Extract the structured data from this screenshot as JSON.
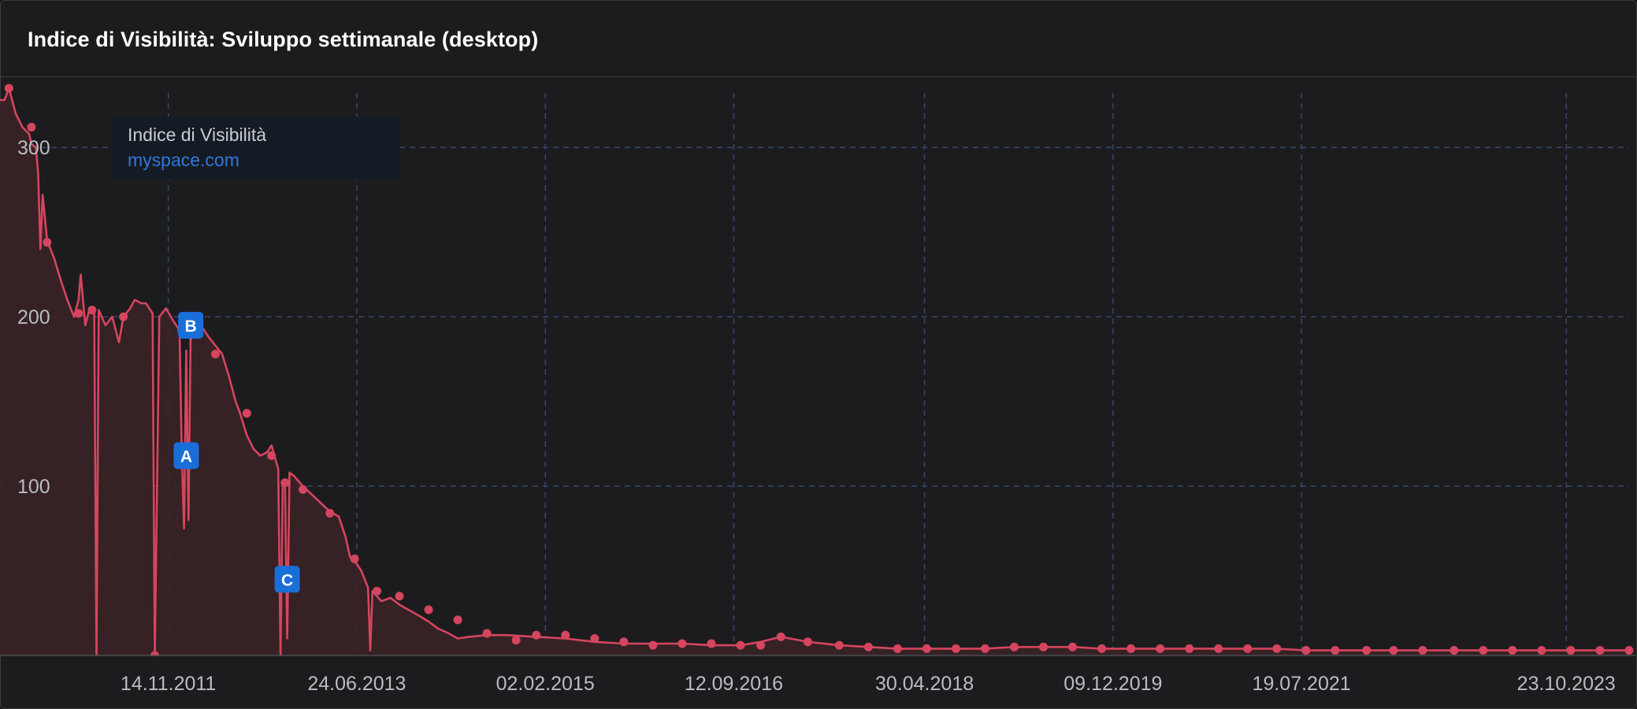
{
  "title": "Indice di Visibilità: Sviluppo settimanale (desktop)",
  "legend": {
    "name": "Indice di Visibilità",
    "domain": "myspace.com"
  },
  "colors": {
    "line": "#d6455f",
    "fill": "#3b2226",
    "marker_bg": "#1a6ed8",
    "grid": "#35466c",
    "background": "#1c1c1e"
  },
  "chart_data": {
    "type": "line",
    "title": "Indice di Visibilità: Sviluppo settimanale (desktop)",
    "xlabel": "",
    "ylabel": "",
    "x_type": "date",
    "xlim": [
      "2010-06-07",
      "2024-05-06"
    ],
    "ylim": [
      0,
      335
    ],
    "grid": true,
    "legend_position": "top-left",
    "x_ticks": [
      "14.11.2011",
      "24.06.2013",
      "02.02.2015",
      "12.09.2016",
      "30.04.2018",
      "09.12.2019",
      "19.07.2021",
      "23.10.2023"
    ],
    "x_tick_dates": [
      "2011-11-14",
      "2013-06-24",
      "2015-02-02",
      "2016-09-12",
      "2018-04-30",
      "2019-12-09",
      "2021-07-19",
      "2023-10-23"
    ],
    "y_ticks": [
      100,
      200,
      300
    ],
    "series": [
      {
        "name": "myspace.com",
        "points": [
          [
            "2010-06-07",
            328
          ],
          [
            "2010-06-21",
            328
          ],
          [
            "2010-07-05",
            335
          ],
          [
            "2010-07-26",
            320
          ],
          [
            "2010-08-16",
            312
          ],
          [
            "2010-09-06",
            308
          ],
          [
            "2010-09-13",
            302
          ],
          [
            "2010-09-27",
            300
          ],
          [
            "2010-10-04",
            285
          ],
          [
            "2010-10-11",
            240
          ],
          [
            "2010-10-18",
            272
          ],
          [
            "2010-11-01",
            245
          ],
          [
            "2010-11-22",
            235
          ],
          [
            "2010-12-13",
            222
          ],
          [
            "2011-01-03",
            210
          ],
          [
            "2011-01-24",
            200
          ],
          [
            "2011-02-07",
            210
          ],
          [
            "2011-02-14",
            225
          ],
          [
            "2011-02-28",
            195
          ],
          [
            "2011-03-14",
            205
          ],
          [
            "2011-03-28",
            203
          ],
          [
            "2011-04-04",
            0
          ],
          [
            "2011-04-11",
            204
          ],
          [
            "2011-05-02",
            195
          ],
          [
            "2011-05-23",
            200
          ],
          [
            "2011-06-13",
            185
          ],
          [
            "2011-06-27",
            200
          ],
          [
            "2011-07-18",
            205
          ],
          [
            "2011-08-01",
            210
          ],
          [
            "2011-08-22",
            208
          ],
          [
            "2011-09-05",
            208
          ],
          [
            "2011-09-26",
            202
          ],
          [
            "2011-10-03",
            0
          ],
          [
            "2011-10-17",
            200
          ],
          [
            "2011-11-07",
            205
          ],
          [
            "2011-11-28",
            198
          ],
          [
            "2011-12-19",
            192
          ],
          [
            "2011-12-26",
            120
          ],
          [
            "2012-01-02",
            75
          ],
          [
            "2012-01-09",
            180
          ],
          [
            "2012-01-16",
            80
          ],
          [
            "2012-01-23",
            195
          ],
          [
            "2012-02-13",
            192
          ],
          [
            "2012-02-27",
            194
          ],
          [
            "2012-03-19",
            188
          ],
          [
            "2012-04-09",
            183
          ],
          [
            "2012-04-30",
            178
          ],
          [
            "2012-05-21",
            165
          ],
          [
            "2012-06-11",
            150
          ],
          [
            "2012-06-25",
            143
          ],
          [
            "2012-07-16",
            130
          ],
          [
            "2012-08-06",
            122
          ],
          [
            "2012-08-27",
            118
          ],
          [
            "2012-09-17",
            120
          ],
          [
            "2012-10-01",
            124
          ],
          [
            "2012-10-22",
            110
          ],
          [
            "2012-10-29",
            0
          ],
          [
            "2012-11-05",
            102
          ],
          [
            "2012-11-12",
            102
          ],
          [
            "2012-11-19",
            10
          ],
          [
            "2012-11-26",
            108
          ],
          [
            "2012-12-10",
            106
          ],
          [
            "2013-01-07",
            100
          ],
          [
            "2013-02-04",
            95
          ],
          [
            "2013-03-04",
            90
          ],
          [
            "2013-04-01",
            85
          ],
          [
            "2013-04-29",
            82
          ],
          [
            "2013-05-20",
            70
          ],
          [
            "2013-06-03",
            58
          ],
          [
            "2013-06-17",
            56
          ],
          [
            "2013-07-08",
            50
          ],
          [
            "2013-07-29",
            40
          ],
          [
            "2013-08-05",
            3
          ],
          [
            "2013-08-12",
            38
          ],
          [
            "2013-09-09",
            32
          ],
          [
            "2013-10-07",
            34
          ],
          [
            "2013-11-04",
            30
          ],
          [
            "2013-12-02",
            27
          ],
          [
            "2013-12-30",
            24
          ],
          [
            "2014-02-03",
            20
          ],
          [
            "2014-03-03",
            16
          ],
          [
            "2014-04-07",
            13
          ],
          [
            "2014-05-05",
            10
          ],
          [
            "2014-06-09",
            11
          ],
          [
            "2014-08-04",
            12
          ],
          [
            "2014-10-06",
            12
          ],
          [
            "2015-01-05",
            11
          ],
          [
            "2015-04-06",
            10
          ],
          [
            "2015-07-06",
            8
          ],
          [
            "2015-10-05",
            7
          ],
          [
            "2016-01-04",
            7
          ],
          [
            "2016-04-04",
            7
          ],
          [
            "2016-07-04",
            6
          ],
          [
            "2016-10-03",
            6
          ],
          [
            "2016-12-05",
            8
          ],
          [
            "2017-02-06",
            11
          ],
          [
            "2017-05-01",
            8
          ],
          [
            "2017-08-07",
            6
          ],
          [
            "2017-11-06",
            5
          ],
          [
            "2018-02-05",
            4
          ],
          [
            "2018-05-07",
            4
          ],
          [
            "2018-08-06",
            4
          ],
          [
            "2018-11-05",
            4
          ],
          [
            "2019-02-04",
            5
          ],
          [
            "2019-05-06",
            5
          ],
          [
            "2019-08-05",
            5
          ],
          [
            "2019-11-04",
            4
          ],
          [
            "2020-02-03",
            4
          ],
          [
            "2020-05-04",
            4
          ],
          [
            "2020-08-03",
            4
          ],
          [
            "2020-11-02",
            4
          ],
          [
            "2021-02-01",
            4
          ],
          [
            "2021-05-03",
            4
          ],
          [
            "2021-08-02",
            3
          ],
          [
            "2021-11-01",
            3
          ],
          [
            "2022-02-07",
            3
          ],
          [
            "2022-05-02",
            3
          ],
          [
            "2022-08-01",
            3
          ],
          [
            "2022-11-07",
            3
          ],
          [
            "2023-02-06",
            3
          ],
          [
            "2023-05-08",
            3
          ],
          [
            "2023-08-07",
            3
          ],
          [
            "2023-11-06",
            3
          ],
          [
            "2024-02-05",
            3
          ],
          [
            "2024-05-06",
            3
          ]
        ],
        "marked_points": [
          [
            "2010-07-05",
            335
          ],
          [
            "2010-09-13",
            312
          ],
          [
            "2010-11-01",
            244
          ],
          [
            "2011-02-07",
            202
          ],
          [
            "2011-03-21",
            204
          ],
          [
            "2011-06-27",
            200
          ],
          [
            "2011-10-03",
            0
          ],
          [
            "2011-12-26",
            192
          ],
          [
            "2012-02-13",
            194
          ],
          [
            "2012-04-09",
            178
          ],
          [
            "2012-07-16",
            143
          ],
          [
            "2012-10-01",
            118
          ],
          [
            "2012-11-12",
            102
          ],
          [
            "2013-01-07",
            98
          ],
          [
            "2013-04-01",
            84
          ],
          [
            "2013-06-17",
            57
          ],
          [
            "2013-08-26",
            38
          ],
          [
            "2013-11-04",
            35
          ],
          [
            "2014-02-03",
            27
          ],
          [
            "2014-05-05",
            21
          ],
          [
            "2014-08-04",
            13
          ],
          [
            "2014-11-03",
            9
          ],
          [
            "2015-01-05",
            12
          ],
          [
            "2015-04-06",
            12
          ],
          [
            "2015-07-06",
            10
          ],
          [
            "2015-10-05",
            8
          ],
          [
            "2016-01-04",
            6
          ],
          [
            "2016-04-04",
            7
          ],
          [
            "2016-07-04",
            7
          ],
          [
            "2016-10-03",
            6
          ],
          [
            "2016-12-05",
            6
          ],
          [
            "2017-02-06",
            11
          ],
          [
            "2017-05-01",
            8
          ],
          [
            "2017-08-07",
            6
          ],
          [
            "2017-11-06",
            5
          ],
          [
            "2018-02-05",
            4
          ],
          [
            "2018-05-07",
            4
          ],
          [
            "2018-08-06",
            4
          ],
          [
            "2018-11-05",
            4
          ],
          [
            "2019-02-04",
            5
          ],
          [
            "2019-05-06",
            5
          ],
          [
            "2019-08-05",
            5
          ],
          [
            "2019-11-04",
            4
          ],
          [
            "2020-02-03",
            4
          ],
          [
            "2020-05-04",
            4
          ],
          [
            "2020-08-03",
            4
          ],
          [
            "2020-11-02",
            4
          ],
          [
            "2021-02-01",
            4
          ],
          [
            "2021-05-03",
            4
          ],
          [
            "2021-08-02",
            3
          ],
          [
            "2021-11-01",
            3
          ],
          [
            "2022-02-07",
            3
          ],
          [
            "2022-05-02",
            3
          ],
          [
            "2022-08-01",
            3
          ],
          [
            "2022-11-07",
            3
          ],
          [
            "2023-02-06",
            3
          ],
          [
            "2023-05-08",
            3
          ],
          [
            "2023-08-07",
            3
          ],
          [
            "2023-11-06",
            3
          ],
          [
            "2024-02-05",
            3
          ],
          [
            "2024-05-06",
            3
          ]
        ]
      }
    ],
    "annotations": [
      {
        "label": "A",
        "date": "2012-01-09",
        "y": 118
      },
      {
        "label": "B",
        "date": "2012-01-23",
        "y": 195
      },
      {
        "label": "C",
        "date": "2012-11-19",
        "y": 45
      }
    ]
  }
}
